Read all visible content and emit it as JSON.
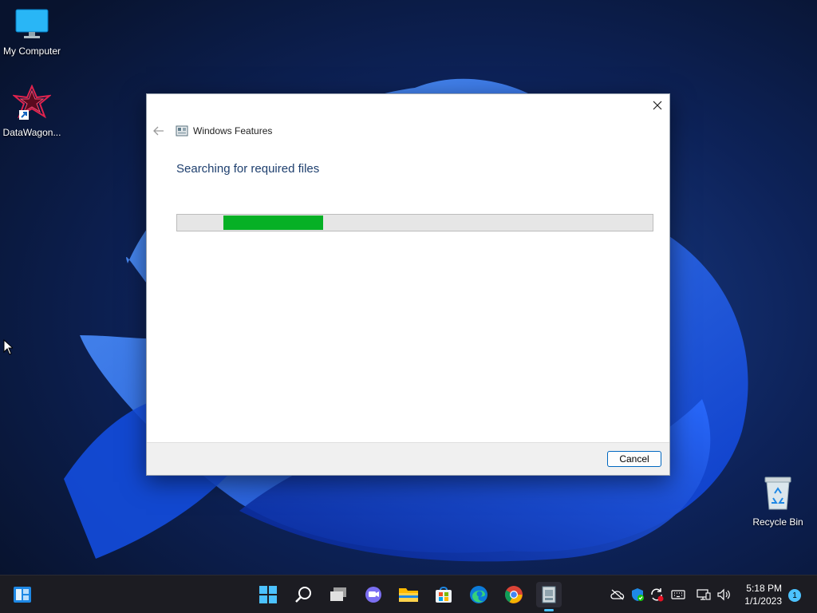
{
  "desktop": {
    "icons": [
      {
        "label": "My Computer"
      },
      {
        "label": "DataWagon..."
      },
      {
        "label": "Recycle Bin"
      }
    ]
  },
  "dialog": {
    "title": "Windows Features",
    "heading": "Searching for required files",
    "progress_fraction": 0.21,
    "cancel_label": "Cancel"
  },
  "taskbar": {
    "pinned": [
      "windows-start-icon",
      "search-icon",
      "task-view-icon",
      "chat-icon",
      "file-explorer-icon",
      "microsoft-store-icon",
      "edge-icon",
      "chrome-icon",
      "windows-features-icon"
    ],
    "clock": {
      "time": "5:18 PM",
      "date": "1/1/2023"
    },
    "notification_count": "1"
  },
  "colors": {
    "progress_fill": "#06b025",
    "heading": "#1e3f6e",
    "accent": "#0067c0"
  }
}
